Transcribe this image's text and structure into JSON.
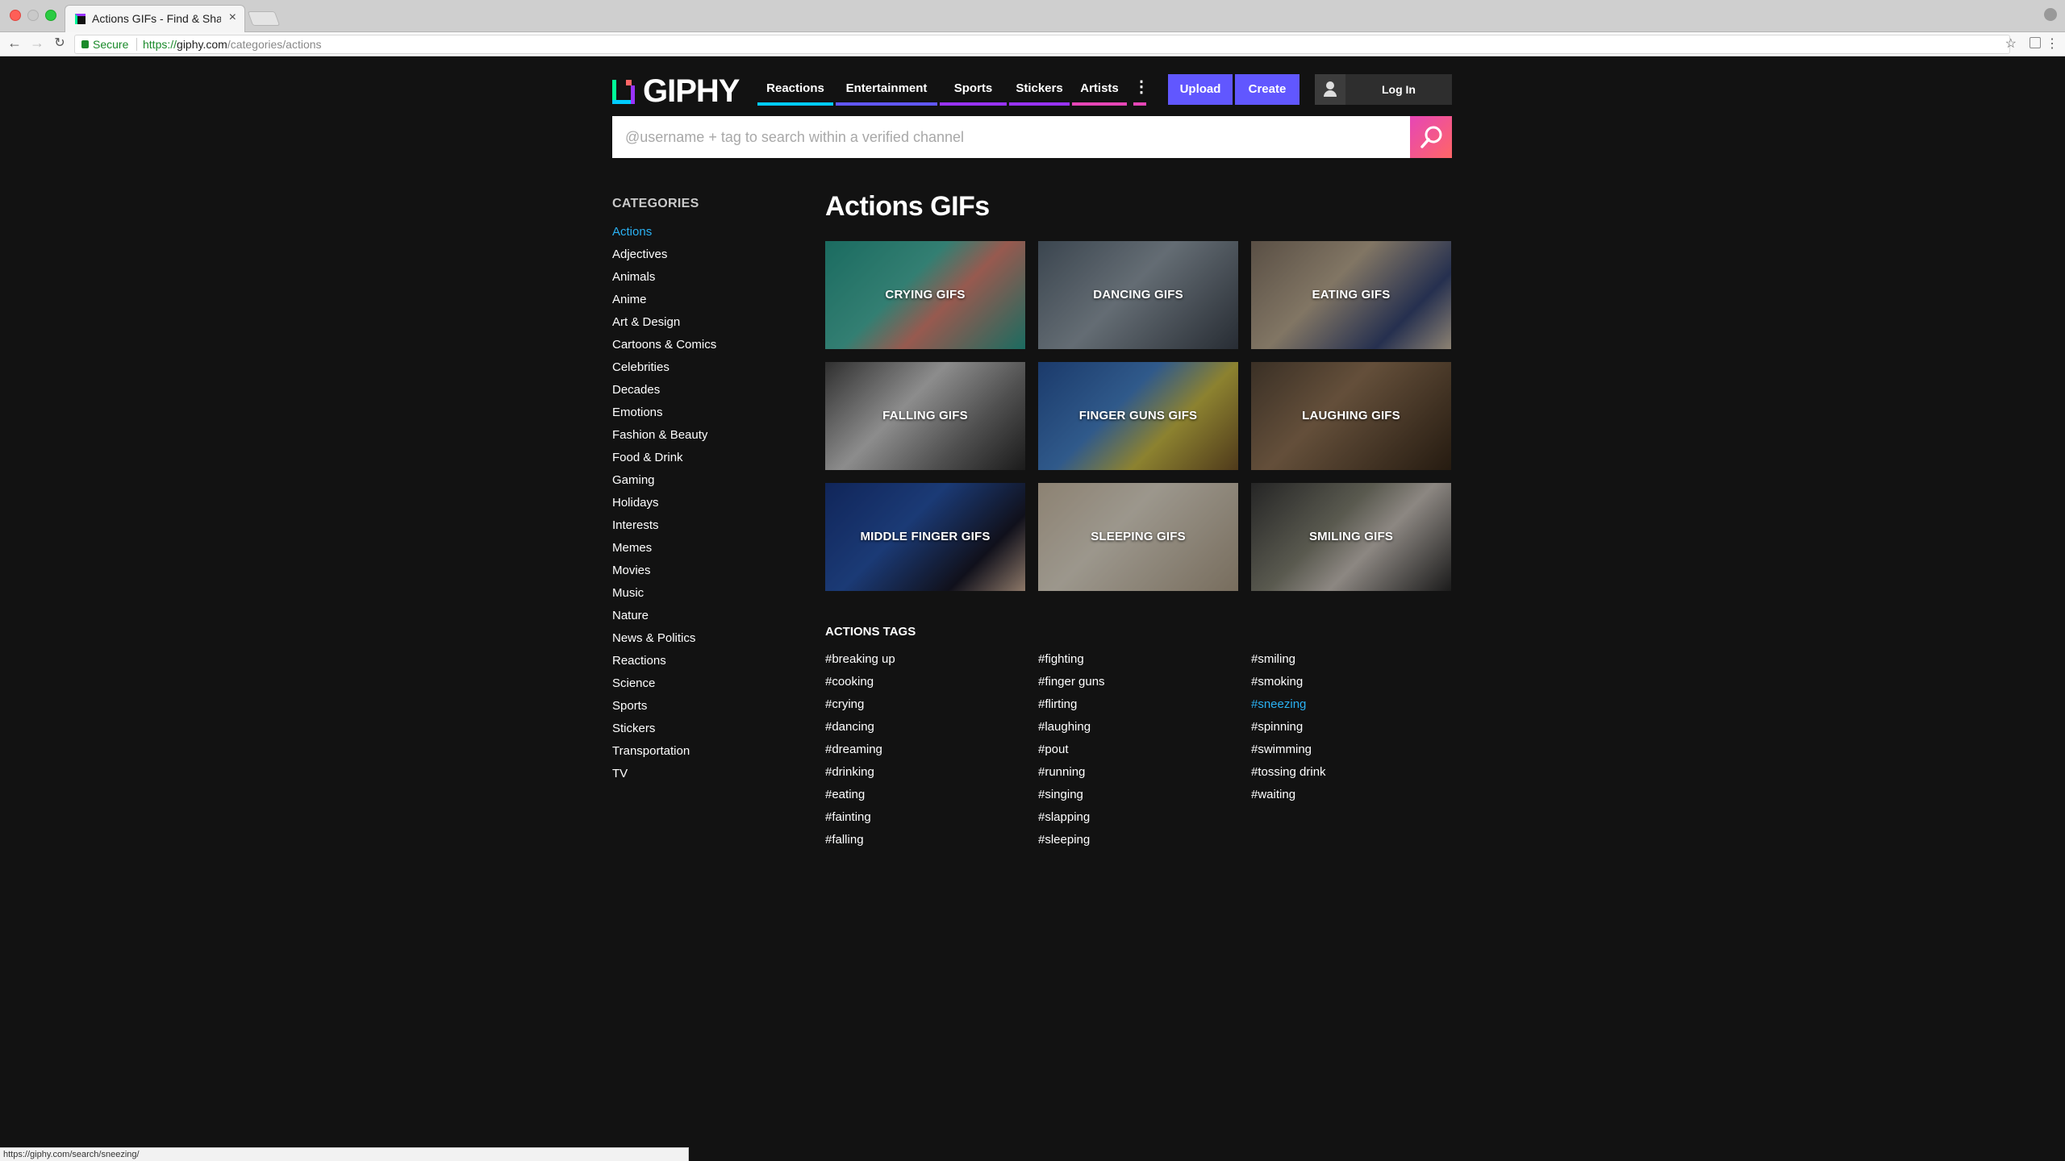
{
  "browser": {
    "tab_title": "Actions GIFs - Find & Share on GIPHY",
    "tab_close": "×",
    "secure_label": "Secure",
    "url_scheme": "https://",
    "url_host": "giphy.com",
    "url_path": "/categories/actions",
    "status_url": "https://giphy.com/search/sneezing/"
  },
  "header": {
    "logo_text": "GIPHY",
    "nav": [
      {
        "label": "Reactions",
        "color": "#00ccff"
      },
      {
        "label": "Entertainment",
        "color": "#6157ff"
      },
      {
        "label": "Sports",
        "color": "#9933ff"
      },
      {
        "label": "Stickers",
        "color": "#9933ff"
      },
      {
        "label": "Artists",
        "color": "#e646b6"
      }
    ],
    "more_color": "#e646b6",
    "upload_label": "Upload",
    "create_label": "Create",
    "login_label": "Log In"
  },
  "search": {
    "placeholder": "@username + tag to search within a verified channel"
  },
  "sidebar": {
    "heading": "CATEGORIES",
    "items": [
      "Actions",
      "Adjectives",
      "Animals",
      "Anime",
      "Art & Design",
      "Cartoons & Comics",
      "Celebrities",
      "Decades",
      "Emotions",
      "Fashion & Beauty",
      "Food & Drink",
      "Gaming",
      "Holidays",
      "Interests",
      "Memes",
      "Movies",
      "Music",
      "Nature",
      "News & Politics",
      "Reactions",
      "Science",
      "Sports",
      "Stickers",
      "Transportation",
      "TV"
    ],
    "active_index": 0
  },
  "main": {
    "title": "Actions GIFs",
    "tiles": [
      {
        "label": "CRYING GIFS",
        "bg": "linear-gradient(135deg,#2aa594 0%,#4fc3b0 40%,#e88a7a 60%,#2aa594 100%)"
      },
      {
        "label": "DANCING GIFS",
        "bg": "linear-gradient(135deg,#5b6b7a 0%,#9aa7b2 45%,#3d4550 100%)"
      },
      {
        "label": "EATING GIFS",
        "bg": "linear-gradient(135deg,#8a7a6a 0%,#c7b59a 40%,#3a4a7a 75%,#d8c8b0 100%)"
      },
      {
        "label": "FALLING GIFS",
        "bg": "linear-gradient(135deg,#4a4a4a 0%,#d8d8d8 40%,#7a7a7a 70%,#2a2a2a 100%)"
      },
      {
        "label": "FINGER GUNS GIFS",
        "bg": "linear-gradient(135deg,#2a5aa5 0%,#4a8ad5 40%,#d8c84a 65%,#7a5a2a 100%)"
      },
      {
        "label": "LAUGHING GIFS",
        "bg": "linear-gradient(135deg,#5a4a3a 0%,#9a7a5a 40%,#3a2a1a 100%)"
      },
      {
        "label": "MIDDLE FINGER GIFS",
        "bg": "linear-gradient(135deg,#1a3a8a 0%,#2a5ab5 40%,#1a1a2a 75%,#d8b8a0 100%)"
      },
      {
        "label": "SLEEPING GIFS",
        "bg": "linear-gradient(135deg,#d8c8b0 0%,#f0e8d8 40%,#b8a890 100%)"
      },
      {
        "label": "SMILING GIFS",
        "bg": "linear-gradient(135deg,#3a3a3a 0%,#8a8a7a 40%,#d8d0c8 60%,#2a2a2a 100%)"
      }
    ],
    "tags_heading": "ACTIONS TAGS",
    "tag_columns": [
      [
        "#breaking up",
        "#cooking",
        "#crying",
        "#dancing",
        "#dreaming",
        "#drinking",
        "#eating",
        "#fainting",
        "#falling"
      ],
      [
        "#fighting",
        "#finger guns",
        "#flirting",
        "#laughing",
        "#pout",
        "#running",
        "#singing",
        "#slapping",
        "#sleeping"
      ],
      [
        "#smiling",
        "#smoking",
        "#sneezing",
        "#spinning",
        "#swimming",
        "#tossing drink",
        "#waiting"
      ]
    ],
    "active_tag": "#sneezing"
  }
}
